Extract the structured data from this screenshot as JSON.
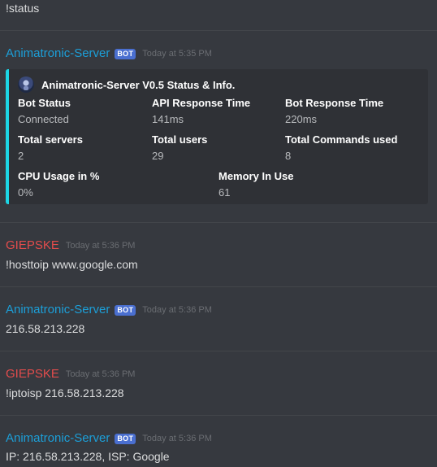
{
  "messages": [
    {
      "content": "!status"
    },
    {
      "author": "Animatronic-Server",
      "bot_tag": "BOT",
      "timestamp": "Today at 5:35 PM",
      "embed": {
        "author": "Animatronic-Server V0.5 Status & Info.",
        "fields": [
          {
            "name": "Bot Status",
            "value": "Connected"
          },
          {
            "name": "API Response Time",
            "value": "141ms"
          },
          {
            "name": "Bot Response Time",
            "value": "220ms"
          },
          {
            "name": "Total servers",
            "value": "2"
          },
          {
            "name": "Total users",
            "value": "29"
          },
          {
            "name": "Total Commands used",
            "value": "8"
          },
          {
            "name": "CPU Usage in %",
            "value": "0%"
          },
          {
            "name": "Memory In Use",
            "value": "61"
          }
        ],
        "accent_color": "#1cd6e6"
      }
    },
    {
      "author": "GIEPSKE",
      "timestamp": "Today at 5:36 PM",
      "content": "!hosttoip www.google.com"
    },
    {
      "author": "Animatronic-Server",
      "bot_tag": "BOT",
      "timestamp": "Today at 5:36 PM",
      "content": "216.58.213.228"
    },
    {
      "author": "GIEPSKE",
      "timestamp": "Today at 5:36 PM",
      "content": "!iptoisp 216.58.213.228"
    },
    {
      "author": "Animatronic-Server",
      "bot_tag": "BOT",
      "timestamp": "Today at 5:36 PM",
      "content": "IP: 216.58.213.228, ISP: Google"
    }
  ],
  "colors": {
    "background": "#36393f",
    "bot_name": "#1c9fd8",
    "user_name": "#e34c4c",
    "bot_tag": "#4a6fd0",
    "embed_background": "#2f3136"
  }
}
